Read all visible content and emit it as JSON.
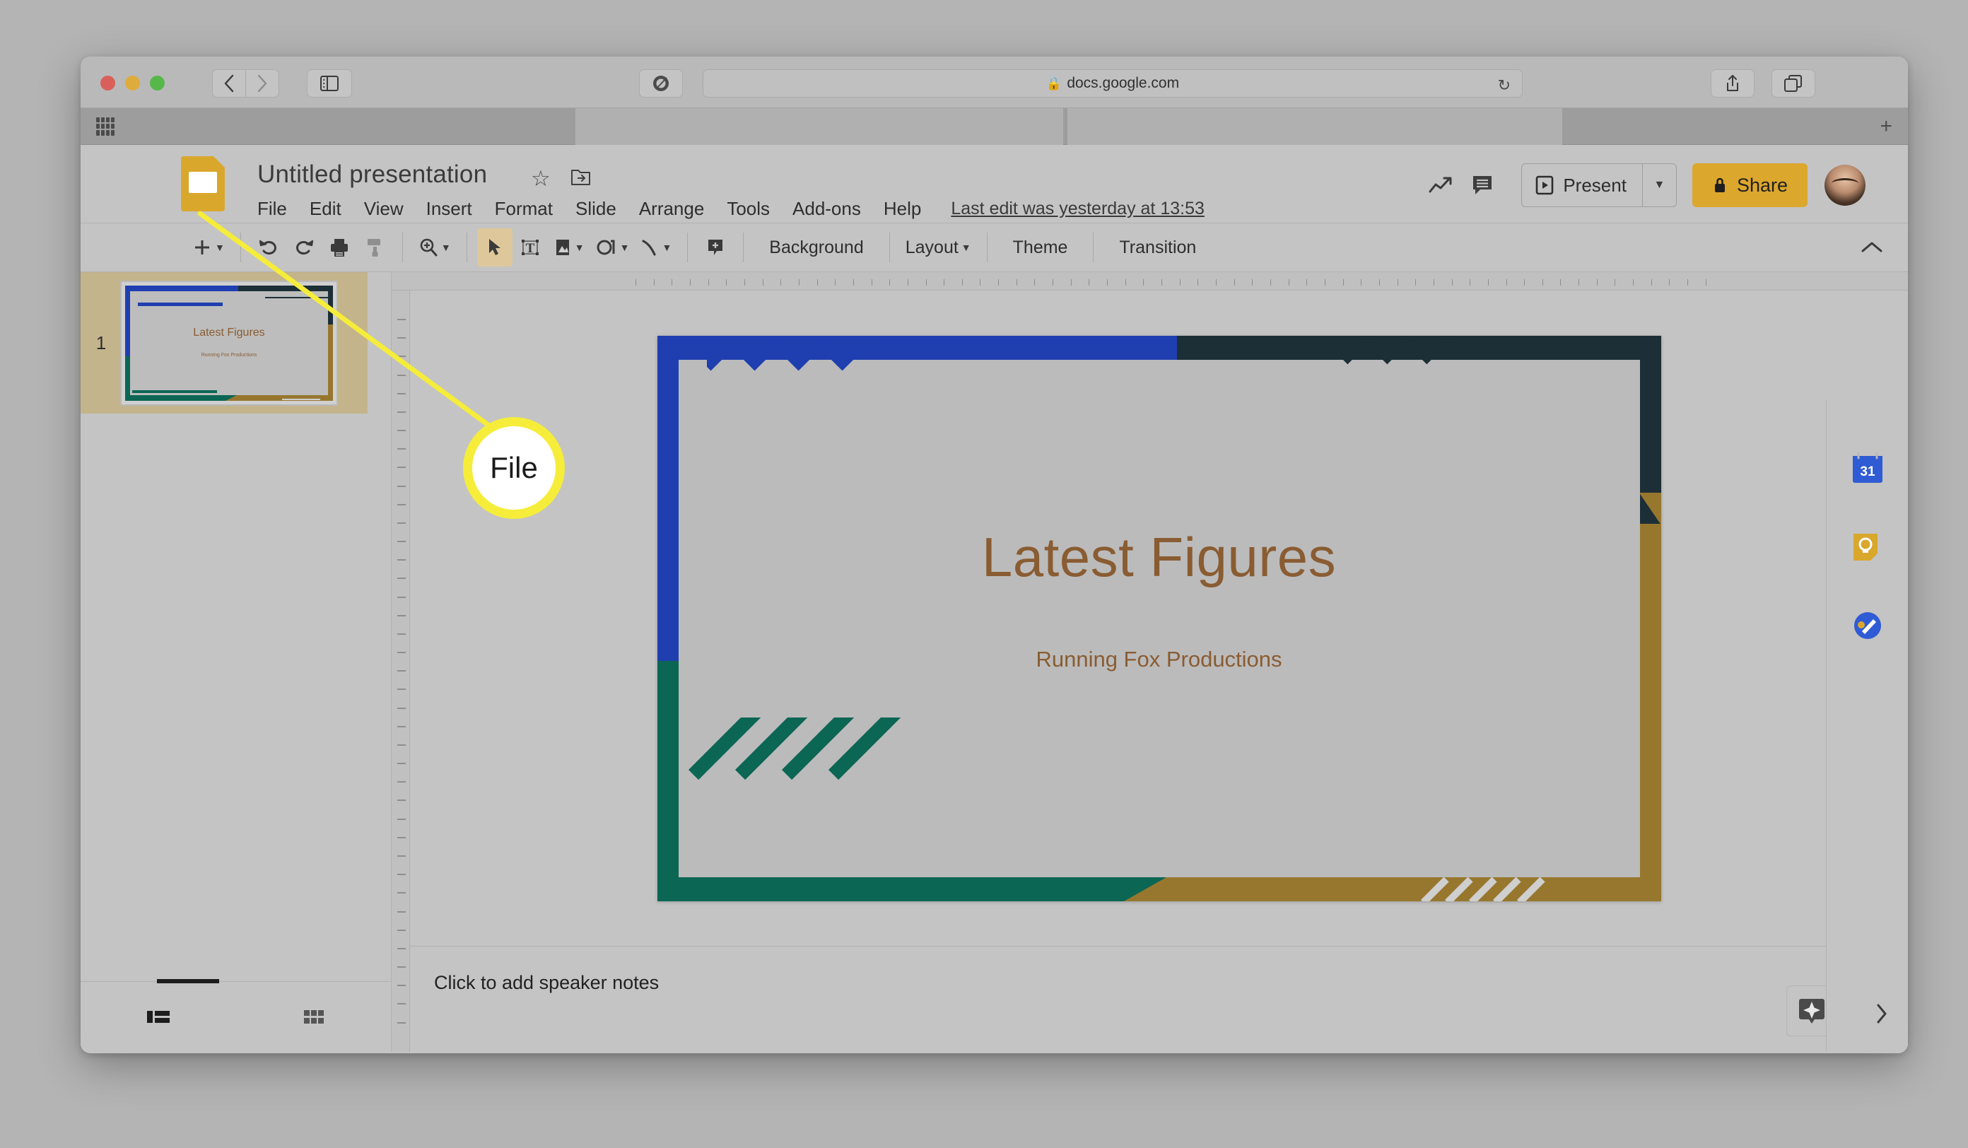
{
  "browser": {
    "url": "docs.google.com",
    "lock_icon": "lock-icon",
    "reload_icon": "reload-icon",
    "back_icon": "back-chevron-icon",
    "forward_icon": "forward-chevron-icon",
    "sidebar_icon": "sidebar-toggle-icon",
    "extension_icon": "ghostery-extension-icon",
    "share_icon": "share-icon",
    "tabs_icon": "show-tabs-icon",
    "newtab_icon": "new-tab-plus-icon",
    "apps_grid_icon": "apps-grid-icon"
  },
  "app": {
    "title": "Untitled presentation",
    "logo_icon": "google-slides-logo",
    "star_icon": "star-icon",
    "move_icon": "move-to-folder-icon",
    "menus": [
      "File",
      "Edit",
      "View",
      "Insert",
      "Format",
      "Slide",
      "Arrange",
      "Tools",
      "Add-ons",
      "Help"
    ],
    "last_edit": "Last edit was yesterday at 13:53",
    "header_right": {
      "activity_icon": "activity-dashboard-icon",
      "comments_icon": "comment-history-icon",
      "present_label": "Present",
      "present_icon": "present-play-icon",
      "present_caret_icon": "chevron-down-icon",
      "share_label": "Share",
      "share_lock_icon": "lock-icon",
      "avatar_name": "avatar"
    }
  },
  "toolbar": {
    "items": [
      {
        "name": "new-slide-button",
        "icon": "plus-icon",
        "caret": true
      },
      {
        "name": "undo-button",
        "icon": "undo-arrow-icon"
      },
      {
        "name": "redo-button",
        "icon": "redo-arrow-icon"
      },
      {
        "name": "print-button",
        "icon": "printer-icon"
      },
      {
        "name": "paint-format-button",
        "icon": "paint-format-icon"
      },
      {
        "name": "zoom-button",
        "icon": "zoom-magnifier-icon",
        "caret": true
      },
      {
        "name": "select-tool-button",
        "icon": "cursor-arrow-icon",
        "selected": true
      },
      {
        "name": "text-box-button",
        "icon": "text-box-icon"
      },
      {
        "name": "image-button",
        "icon": "image-icon",
        "caret": true
      },
      {
        "name": "shape-button",
        "icon": "shape-icon",
        "caret": true
      },
      {
        "name": "line-button",
        "icon": "line-icon",
        "caret": true
      },
      {
        "name": "comment-button",
        "icon": "add-comment-icon"
      }
    ],
    "background_label": "Background",
    "layout_label": "Layout",
    "layout_caret_icon": "chevron-down-icon",
    "theme_label": "Theme",
    "transition_label": "Transition",
    "collapse_icon": "collapse-toolbar-chevron-icon"
  },
  "filmstrip": {
    "slides": [
      {
        "number": "1",
        "title": "Latest Figures",
        "subtitle": "Running Fox Productions"
      }
    ],
    "view_filmstrip_icon": "filmstrip-view-icon",
    "view_grid_icon": "grid-view-icon"
  },
  "slide": {
    "title": "Latest Figures",
    "subtitle": "Running Fox Productions",
    "dots": "• • •",
    "colors": {
      "blue": "#1f3fb0",
      "dark": "#1c2f37",
      "green": "#0b6654",
      "gold": "#97772e",
      "background": "#bbbbbb",
      "text": "#8a5c32"
    }
  },
  "notes": {
    "placeholder": "Click to add speaker notes",
    "explore_icon": "explore-star-icon"
  },
  "right_rail": {
    "calendar_icon": "google-calendar-icon",
    "calendar_day": "31",
    "keep_icon": "google-keep-icon",
    "tasks_icon": "google-tasks-icon",
    "expand_icon": "expand-side-panel-chevron-icon"
  },
  "annotation": {
    "callout_label": "File",
    "callout_color": "#f5ed3a"
  }
}
